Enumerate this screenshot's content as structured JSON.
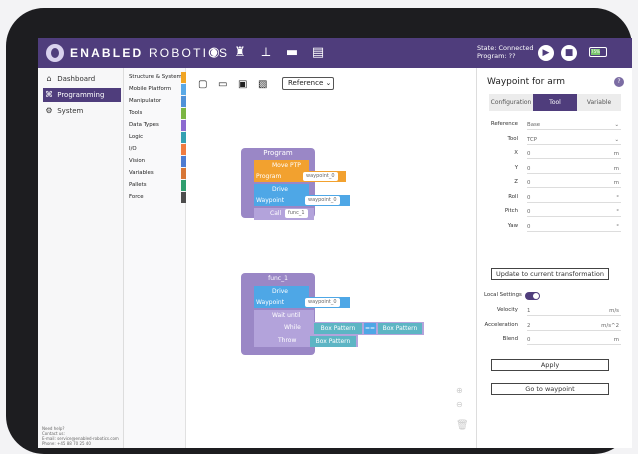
{
  "header": {
    "brand_bold": "ENABLED",
    "brand_light": " ROBOTICS",
    "status_line1": "State: Connected",
    "status_line2": "Program: ??",
    "battery": "75%"
  },
  "nav": [
    {
      "label": "Dashboard",
      "icon": "home-icon",
      "glyph": "⌂"
    },
    {
      "label": "Programming",
      "icon": "code-icon",
      "glyph": "⌘"
    },
    {
      "label": "System",
      "icon": "settings-icon",
      "glyph": "⚙"
    }
  ],
  "palette": [
    {
      "label": "Structure & System",
      "color": "#f1a524"
    },
    {
      "label": "Mobile Platform",
      "color": "#5aa9e6"
    },
    {
      "label": "Manipulator",
      "color": "#4f91d8"
    },
    {
      "label": "Tools",
      "color": "#7bb543"
    },
    {
      "label": "Data Types",
      "color": "#8c6ad0"
    },
    {
      "label": "Logic",
      "color": "#34a0b2"
    },
    {
      "label": "I/O",
      "color": "#f07b3f"
    },
    {
      "label": "Vision",
      "color": "#4d7cd1"
    },
    {
      "label": "Variables",
      "color": "#d77636"
    },
    {
      "label": "Pallets",
      "color": "#2f9e6e"
    },
    {
      "label": "Force",
      "color": "#4d4d4d"
    }
  ],
  "contact": "Need help?\nContact us:\nE-mail: service@enabled-robotics.com\nPhone: +45 88 70 25 40\n\nCopyright Enabled Robotics 2022",
  "workspace": {
    "reference_select": "Reference",
    "program_title": "Program",
    "program_label": "Program",
    "move_ptp": "Move PTP",
    "waypoint_label": "Waypoint",
    "waypoint_value": "waypoint_0",
    "drive": "Drive",
    "call": "Call",
    "call_target": "func_1",
    "func_name": "func_1",
    "func_label": "Function",
    "wait_until": "Wait until",
    "while": "While",
    "throw": "Throw",
    "box_pattern": "Box Pattern",
    "operator": "=="
  },
  "panel": {
    "title": "Waypoint for arm",
    "tabs": [
      "Configuration",
      "Tool",
      "Variable"
    ],
    "active_tab": "Tool",
    "fields": [
      {
        "label": "Reference",
        "value": "Base",
        "unit": "⌄"
      },
      {
        "label": "Tool",
        "value": "TCP",
        "unit": "⌄"
      },
      {
        "label": "X",
        "value": "0",
        "unit": "m"
      },
      {
        "label": "Y",
        "value": "0",
        "unit": "m"
      },
      {
        "label": "Z",
        "value": "0",
        "unit": "m"
      },
      {
        "label": "Roll",
        "value": "0",
        "unit": "°"
      },
      {
        "label": "Pitch",
        "value": "0",
        "unit": "°"
      },
      {
        "label": "Yaw",
        "value": "0",
        "unit": "°"
      }
    ],
    "update_button": "Update to current transformation",
    "local_settings": "Local Settings",
    "settings": [
      {
        "label": "Velocity",
        "value": "1",
        "unit": "m/s"
      },
      {
        "label": "Acceleration",
        "value": "2",
        "unit": "m/s^2"
      },
      {
        "label": "Blend",
        "value": "0",
        "unit": "m"
      }
    ],
    "apply_button": "Apply",
    "goto_button": "Go to waypoint"
  }
}
